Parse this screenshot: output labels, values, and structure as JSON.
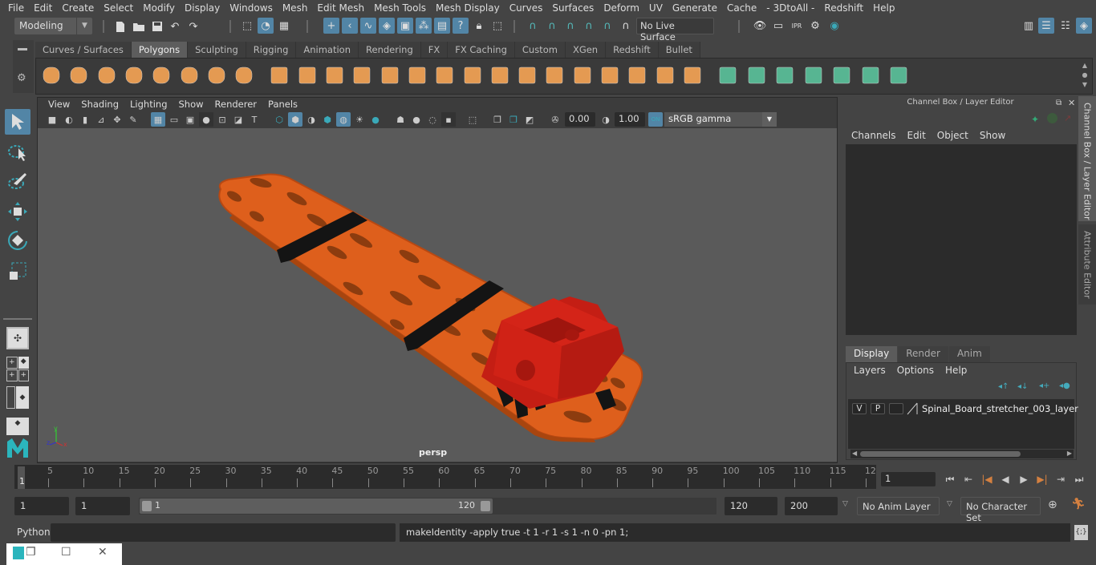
{
  "menubar": [
    "File",
    "Edit",
    "Create",
    "Select",
    "Modify",
    "Display",
    "Windows",
    "Mesh",
    "Edit Mesh",
    "Mesh Tools",
    "Mesh Display",
    "Curves",
    "Surfaces",
    "Deform",
    "UV",
    "Generate",
    "Cache",
    "- 3DtoAll -",
    "Redshift",
    "Help"
  ],
  "toolbar": {
    "mode": "Modeling",
    "live_surface": "No Live Surface",
    "icons": [
      "new-scene-icon",
      "open-scene-icon",
      "save-scene-icon",
      "undo-icon",
      "redo-icon",
      "select-hierarchy-icon",
      "select-object-icon",
      "select-component-icon",
      "snap-grid-icon",
      "snap-curve-icon",
      "snap-point-icon",
      "snap-view-plane-icon",
      "snap-live-icon",
      "snap-edge-icon",
      "snap-render-icon",
      "help-icon",
      "lock-icon",
      "select-lasso-icon"
    ]
  },
  "shelf": {
    "tabs": [
      "Curves / Surfaces",
      "Polygons",
      "Sculpting",
      "Rigging",
      "Animation",
      "Rendering",
      "FX",
      "FX Caching",
      "Custom",
      "XGen",
      "Redshift",
      "Bullet"
    ],
    "active_tab": "Polygons",
    "icons": [
      "poly-sphere-icon",
      "poly-cube-icon",
      "poly-cylinder-icon",
      "poly-cone-icon",
      "poly-plane-icon",
      "poly-torus-icon",
      "poly-pyramid-icon",
      "poly-pipe-icon",
      "combine-icon",
      "separate-icon",
      "mirror-icon",
      "smooth-icon",
      "reduce-icon",
      "extract-icon",
      "multi-cut-icon",
      "bevel-icon",
      "bridge-icon",
      "extrude-icon",
      "insert-edge-loop-icon",
      "append-icon",
      "bevel-edges-icon",
      "target-weld-icon",
      "merge-icon",
      "fill-hole-icon",
      "uv-planar-icon",
      "uv-cylindrical-icon",
      "uv-spherical-icon",
      "uv-auto-icon",
      "uv-unfold-icon",
      "uv-editor-icon",
      "uv-sew-icon"
    ]
  },
  "viewport": {
    "menu": [
      "View",
      "Shading",
      "Lighting",
      "Show",
      "Renderer",
      "Panels"
    ],
    "exposure": "0.00",
    "gamma": "1.00",
    "color_space": "sRGB gamma",
    "camera_label": "persp",
    "axis": {
      "x": "x",
      "y": "y",
      "z": "z"
    }
  },
  "channel_box": {
    "title": "Channel Box / Layer Editor",
    "menu": [
      "Channels",
      "Edit",
      "Object",
      "Show"
    ]
  },
  "layer_editor": {
    "tabs": [
      "Display",
      "Render",
      "Anim"
    ],
    "active_tab": "Display",
    "menu": [
      "Layers",
      "Options",
      "Help"
    ],
    "layers": [
      {
        "v": "V",
        "p": "P",
        "name": "Spinal_Board_stretcher_003_layer"
      }
    ]
  },
  "side_tabs": [
    "Channel Box / Layer Editor",
    "Attribute Editor"
  ],
  "timeline": {
    "ticks": [
      "5",
      "10",
      "15",
      "20",
      "25",
      "30",
      "35",
      "40",
      "45",
      "50",
      "55",
      "60",
      "65",
      "70",
      "75",
      "80",
      "85",
      "90",
      "95",
      "100",
      "105",
      "110",
      "115",
      "12"
    ],
    "current_frame_marker": "1",
    "current_frame": "1"
  },
  "range": {
    "start": "1",
    "current": "1",
    "slider_start": "1",
    "slider_end": "120",
    "end": "120",
    "max": "200",
    "anim_layer": "No Anim Layer",
    "character_set": "No Character Set"
  },
  "command": {
    "language": "Python",
    "input": "",
    "result": "makeIdentity -apply true -t 1 -r 1 -s 1 -n 0 -pn 1;"
  },
  "colors": {
    "accent": "#5285a6",
    "board": "#e0621e",
    "headblock": "#d42418",
    "strap": "#151515",
    "viewport_bg": "#5a5a5a"
  }
}
